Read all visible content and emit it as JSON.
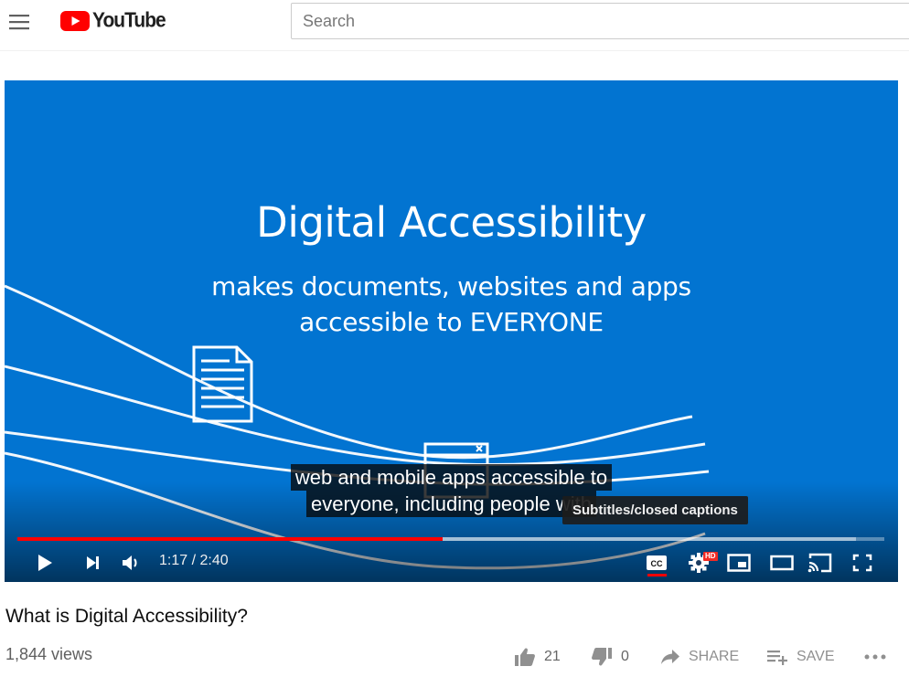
{
  "masthead": {
    "logo_text": "YouTube",
    "search_placeholder": "Search"
  },
  "player": {
    "slide_title": "Digital Accessibility",
    "slide_subtitle_line1": "makes documents, websites and apps",
    "slide_subtitle_line2": "accessible to EVERYONE",
    "caption_line1": "web and mobile apps accessible to",
    "caption_line2": "everyone, including people with",
    "tooltip": "Subtitles/closed captions",
    "time_current": "1:17",
    "time_total": "2:40",
    "time_display": "1:17 / 2:40",
    "progress_played": 0.49,
    "progress_loaded": 0.967,
    "hd_badge": "HD"
  },
  "video": {
    "title": "What is Digital Accessibility?",
    "views": "1,844 views",
    "likes": "21",
    "dislikes": "0",
    "share_label": "SHARE",
    "save_label": "SAVE"
  },
  "colors": {
    "brand_red": "#ff0000",
    "slide_blue": "#0274d1",
    "progress_red": "#ff0000"
  }
}
